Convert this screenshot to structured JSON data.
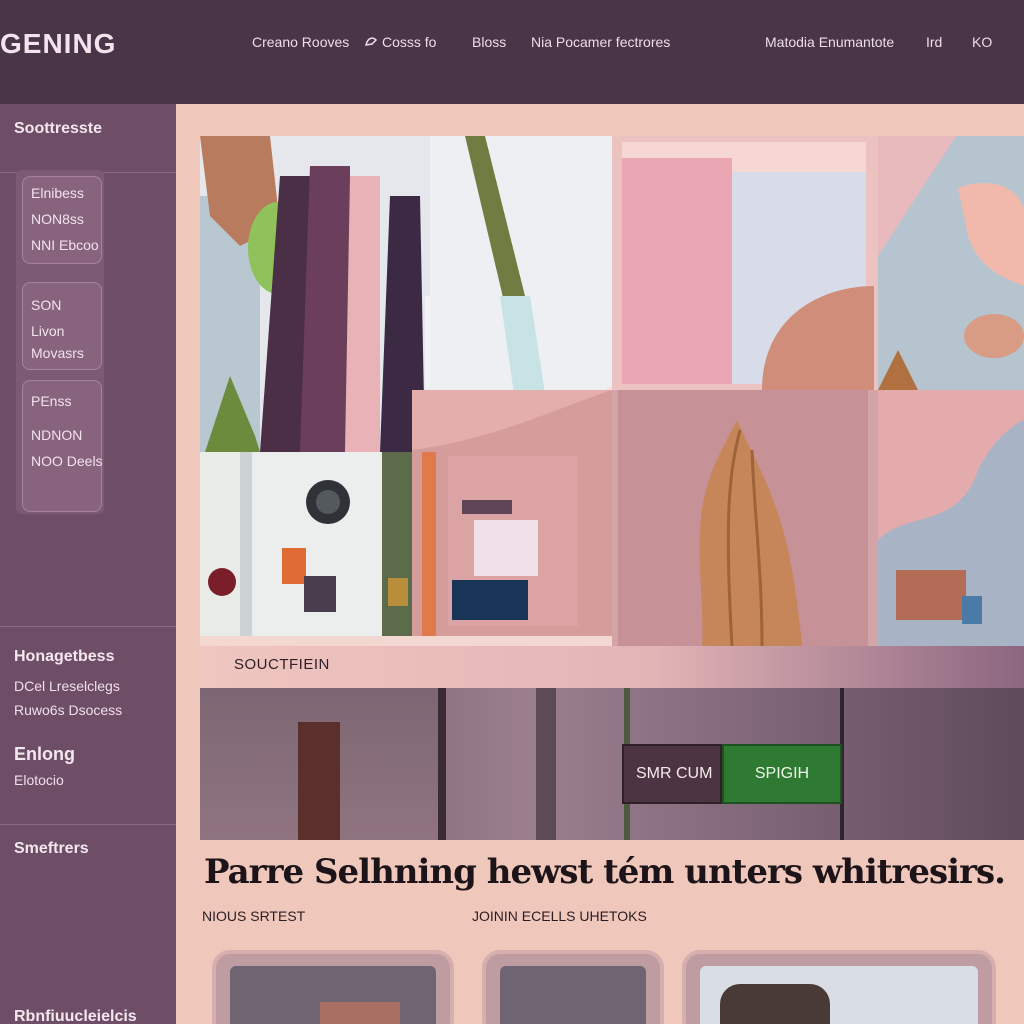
{
  "brand": "GENING",
  "nav": {
    "links": [
      {
        "label": "Creano Rooves",
        "icon": ""
      },
      {
        "label": "Cosss fo",
        "icon": "custom-shape-icon"
      },
      {
        "label": "Bloss",
        "icon": "grid-icon"
      },
      {
        "label": "Nia Pocamer fectrores",
        "icon": ""
      },
      {
        "label": "Matodia Enumantote",
        "icon": ""
      },
      {
        "label": "Ird",
        "icon": ""
      },
      {
        "label": "KO",
        "icon": ""
      }
    ]
  },
  "sidebar": {
    "title": "Soottresste",
    "cards": [
      {
        "lines": [
          "Elnibess",
          "NON8ss",
          "NNI Ebcoo"
        ]
      },
      {
        "lines": [
          "SON",
          "Livon",
          "Movasrs"
        ]
      },
      {
        "lines": [
          "PEnss",
          "NDNON",
          "NOO Deels"
        ]
      }
    ],
    "section2_title": "Honagetbess",
    "section2_items": [
      "DCel Lreselclegs",
      "Ruwo6s Dsocess"
    ],
    "section3_title": "Enlong",
    "section3_item": "Elotocio",
    "section4_title": "Smeftrers",
    "section5_title": "Rbnfiuucleielcis"
  },
  "gallery": {
    "caption": "SOUCTFIEIN"
  },
  "search": {
    "input_value": "SMR CUM",
    "button_label": "SPIGIH"
  },
  "headline": "Parre Selhning hewst tém unters whitresirs.",
  "sublabels": [
    "NIOUS SRTEST",
    "JOININ ECELLS UHETOKS"
  ],
  "colors": {
    "topbar": "#4a3548",
    "sidebar": "#6e4d67",
    "main_bg": "#efc7bb",
    "accent_green": "#2e7a32"
  }
}
